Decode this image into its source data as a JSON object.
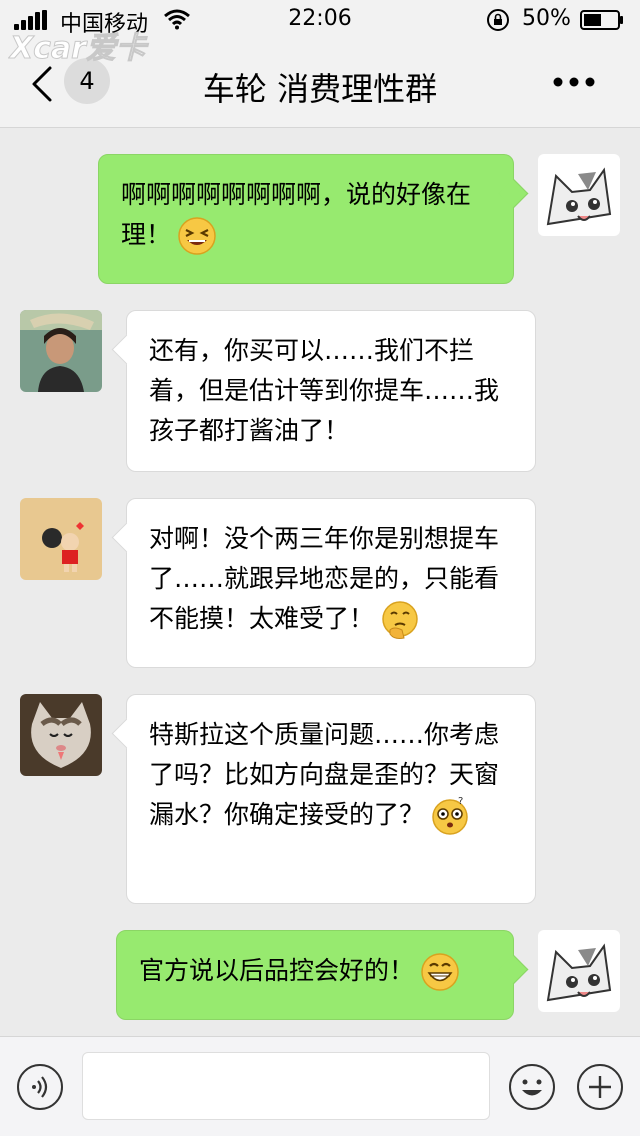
{
  "status_bar": {
    "carrier": "中国移动",
    "time": "22:06",
    "battery": "50%"
  },
  "watermark": {
    "text": "Xcar爱卡"
  },
  "nav": {
    "back_icon": "chevron-left-icon",
    "unread_count": "4",
    "title": "车轮 消费理性群",
    "more_icon": "more-dots-icon"
  },
  "messages": [
    {
      "direction": "outgoing",
      "sender": "self",
      "text": "啊啊啊啊啊啊啊啊，说的好像在理！",
      "emoji": "laughing-squint-emoji"
    },
    {
      "direction": "incoming",
      "sender": "member-1",
      "text": "还有，你买可以……我们不拦着，但是估计等到你提车……我孩子都打酱油了！"
    },
    {
      "direction": "incoming",
      "sender": "member-2",
      "text": "对啊！没个两三年你是别想提车了……就跟异地恋是的，只能看不能摸！太难受了！",
      "emoji": "thinking-emoji"
    },
    {
      "direction": "incoming",
      "sender": "member-3",
      "text": "特斯拉这个质量问题……你考虑了吗？比如方向盘是歪的？天窗漏水？你确定接受的了？",
      "emoji": "dizzy-confused-emoji"
    },
    {
      "direction": "outgoing",
      "sender": "self",
      "text": "官方说以后品控会好的！",
      "emoji": "grinning-emoji"
    }
  ],
  "input_bar": {
    "voice_icon": "voice-icon",
    "text_value": "",
    "emoji_icon": "emoji-icon",
    "plus_icon": "plus-icon"
  },
  "colors": {
    "outgoing_bubble": "#97ea6f",
    "incoming_bubble": "#ffffff",
    "background": "#ebebeb"
  }
}
